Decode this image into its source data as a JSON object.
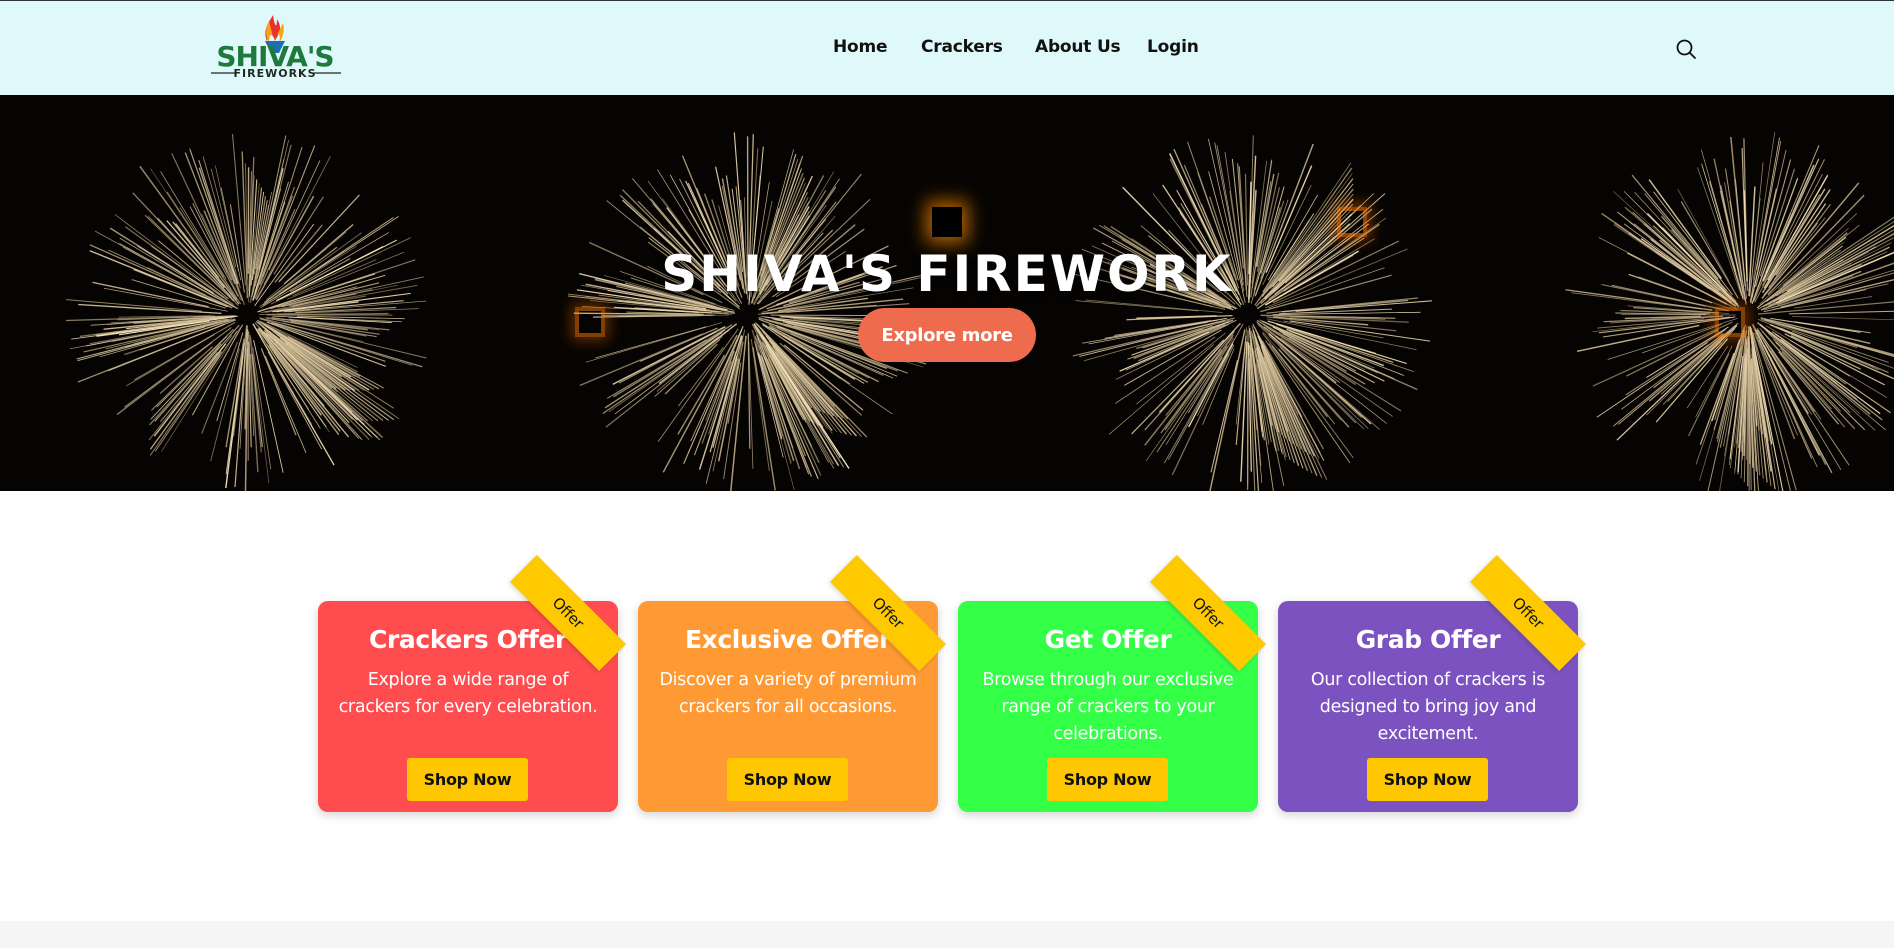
{
  "logo": {
    "brand_name": "SHIVA'S",
    "brand_sub": "FIREWORKS"
  },
  "nav": [
    {
      "label": "Home"
    },
    {
      "label": "Crackers"
    },
    {
      "label": "About Us"
    },
    {
      "label": "Login"
    }
  ],
  "hero": {
    "title": "SHIVA'S FIREWORK",
    "cta_label": "Explore more"
  },
  "offers": [
    {
      "title": "Crackers Offer",
      "description": "Explore a wide range of crackers for every celebration.",
      "button": "Shop Now",
      "badge": "Offer",
      "color": "#ff4c4f"
    },
    {
      "title": "Exclusive Offer",
      "description": "Discover a variety of premium crackers for all occasions.",
      "button": "Shop Now",
      "badge": "Offer",
      "color": "#ff9933"
    },
    {
      "title": "Get Offer",
      "description": "Browse through our exclusive range of crackers to your celebrations.",
      "button": "Shop Now",
      "badge": "Offer",
      "color": "#33ff47"
    },
    {
      "title": "Grab Offer",
      "description": "Our collection of crackers is designed to bring joy and excitement.",
      "button": "Shop Now",
      "badge": "Offer",
      "color": "#7b52bf"
    }
  ],
  "colors": {
    "header_bg": "#dff9fb",
    "accent_button": "#ee6b4d",
    "shop_button": "#ffc700",
    "ribbon": "#ffc900"
  },
  "icons": {
    "search": "search-icon"
  }
}
